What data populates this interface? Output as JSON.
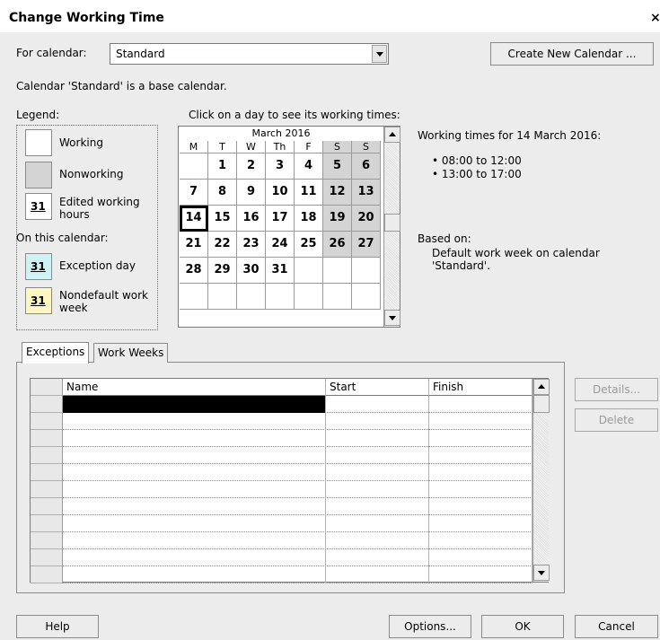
{
  "window": {
    "title": "Change Working Time",
    "close_label": "×"
  },
  "calendar_selector": {
    "label": "For calendar:",
    "value": "Standard",
    "create_button": "Create New Calendar ..."
  },
  "base_info": "Calendar 'Standard' is a base calendar.",
  "legend": {
    "title": "Legend:",
    "items": [
      {
        "label": "Working",
        "color": "#ffffff"
      },
      {
        "label": "Nonworking",
        "color": "#d4d4d4"
      },
      {
        "label": "Edited working hours",
        "number": "31",
        "color": "#ffffff"
      }
    ],
    "on_calendar_title": "On this calendar:",
    "on_calendar_items": [
      {
        "label": "Exception day",
        "number": "31",
        "color": "#cff3f5"
      },
      {
        "label": "Nondefault work week",
        "number": "31",
        "color": "#fdf5c2"
      }
    ]
  },
  "calendar": {
    "prompt": "Click on a day to see its working times:",
    "month_title": "March 2016",
    "day_headers": [
      "M",
      "T",
      "W",
      "Th",
      "F",
      "S",
      "S"
    ],
    "weeks": [
      [
        "",
        "1",
        "2",
        "3",
        "4",
        "5",
        "6"
      ],
      [
        "7",
        "8",
        "9",
        "10",
        "11",
        "12",
        "13"
      ],
      [
        "14",
        "15",
        "16",
        "17",
        "18",
        "19",
        "20"
      ],
      [
        "21",
        "22",
        "23",
        "24",
        "25",
        "26",
        "27"
      ],
      [
        "28",
        "29",
        "30",
        "31",
        "",
        "",
        ""
      ],
      [
        "",
        "",
        "",
        "",
        "",
        "",
        ""
      ]
    ],
    "selected_day": "14",
    "nonworking_color": "#d4d4d4"
  },
  "working_times": {
    "heading": "Working times for 14 March 2016:",
    "ranges": [
      "• 08:00 to 12:00",
      "• 13:00 to 17:00"
    ],
    "based_on_label": "Based on:",
    "based_on_text": "Default work week on calendar 'Standard'."
  },
  "tabs": [
    {
      "label": "Exceptions",
      "active": true
    },
    {
      "label": "Work Weeks",
      "active": false
    }
  ],
  "exceptions_table": {
    "columns": [
      "Name",
      "Start",
      "Finish"
    ],
    "row_count": 11
  },
  "side_buttons": {
    "details": "Details...",
    "delete": "Delete"
  },
  "footer": {
    "help": "Help",
    "options": "Options...",
    "ok": "OK",
    "cancel": "Cancel"
  }
}
